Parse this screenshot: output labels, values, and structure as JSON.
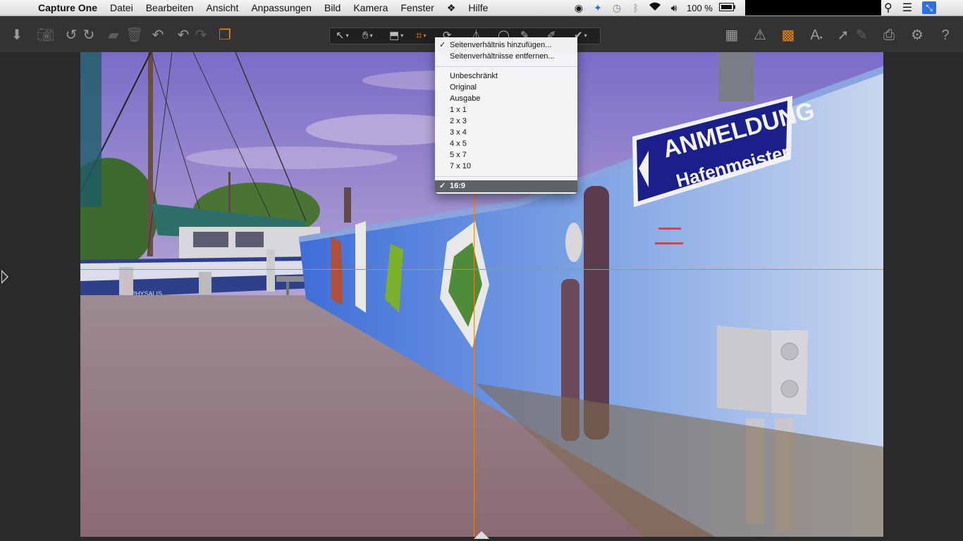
{
  "menubar": {
    "app_name": "Capture One",
    "menus": [
      "Datei",
      "Bearbeiten",
      "Ansicht",
      "Anpassungen",
      "Bild",
      "Kamera",
      "Fenster"
    ],
    "help": "Hilfe",
    "battery": "100 %"
  },
  "toolbar": {
    "left_icons": [
      "import-icon",
      "camera-icon",
      "rotate-left-icon",
      "rotate-right-icon",
      "folder-icon",
      "trash-icon",
      "undo-back-icon",
      "undo-icon",
      "redo-icon",
      "variants-icon"
    ],
    "center_tools": [
      "select-tool",
      "pan-tool",
      "loupe-tool",
      "crop-tool",
      "straighten-tool",
      "keystone-tool",
      "spot-tool",
      "brush-tool",
      "picker-tool",
      "white-balance-tool"
    ],
    "right_icons": [
      "overlay-icon",
      "warning-icon",
      "grid-icon",
      "text-icon",
      "export-icon",
      "edit-icon",
      "print-icon",
      "settings-icon",
      "help-icon"
    ],
    "active_color": "#e8821c"
  },
  "crop_menu": {
    "top_items": [
      {
        "label": "Seitenverhältnis hinzufügen...",
        "checked": true
      },
      {
        "label": "Seitenverhältnisse entfernen..."
      }
    ],
    "ratios": [
      "Unbeschränkt",
      "Original",
      "Ausgabe",
      "1 x 1",
      "2 x 3",
      "3 x 4",
      "4 x 5",
      "5 x 7",
      "7 x 10"
    ],
    "selected": "16:9",
    "selected_check": "✓"
  },
  "photo": {
    "sign_line1": "ANMELDUNG",
    "sign_line2": "Hafenmeister",
    "boat_name": "PHYSALIS",
    "sign_color": "#1a1f8a"
  }
}
